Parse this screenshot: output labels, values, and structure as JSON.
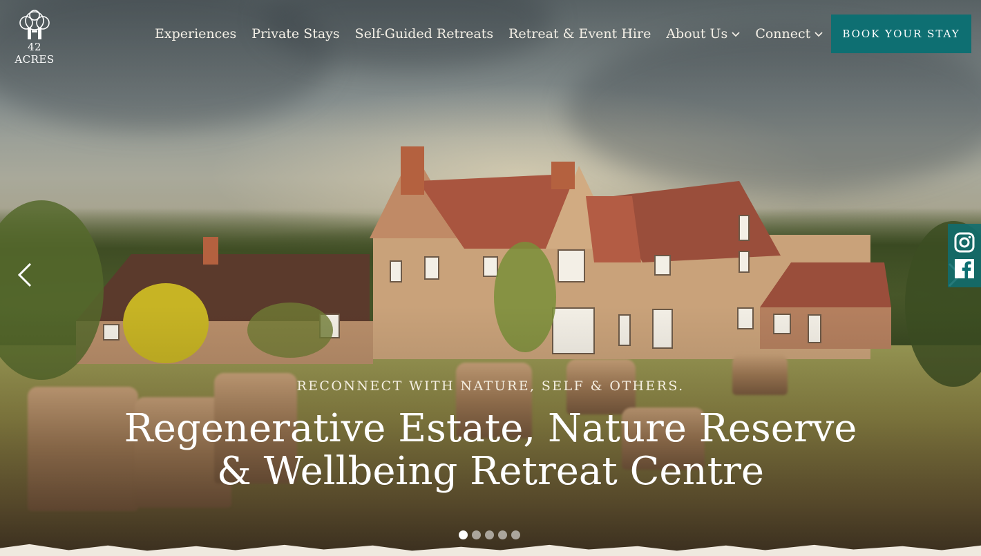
{
  "brand": {
    "logo_text": "42 ACRES"
  },
  "nav": {
    "items": [
      {
        "label": "Experiences",
        "has_dropdown": false
      },
      {
        "label": "Private Stays",
        "has_dropdown": false
      },
      {
        "label": "Self-Guided Retreats",
        "has_dropdown": false
      },
      {
        "label": "Retreat & Event Hire",
        "has_dropdown": false
      },
      {
        "label": "About Us",
        "has_dropdown": true
      },
      {
        "label": "Connect",
        "has_dropdown": true
      }
    ],
    "cta_label": "BOOK YOUR STAY"
  },
  "hero": {
    "eyebrow": "RECONNECT WITH NATURE, SELF & OTHERS.",
    "headline_line1": "Regenerative Estate, Nature Reserve",
    "headline_line2": "& Wellbeing Retreat Centre",
    "slides_total": 5,
    "active_slide": 1
  },
  "social": {
    "icons": [
      "instagram-icon",
      "facebook-icon"
    ]
  },
  "colors": {
    "accent": "#0e6f72",
    "text_light": "#ffffff",
    "page_bg": "#efe9df"
  }
}
